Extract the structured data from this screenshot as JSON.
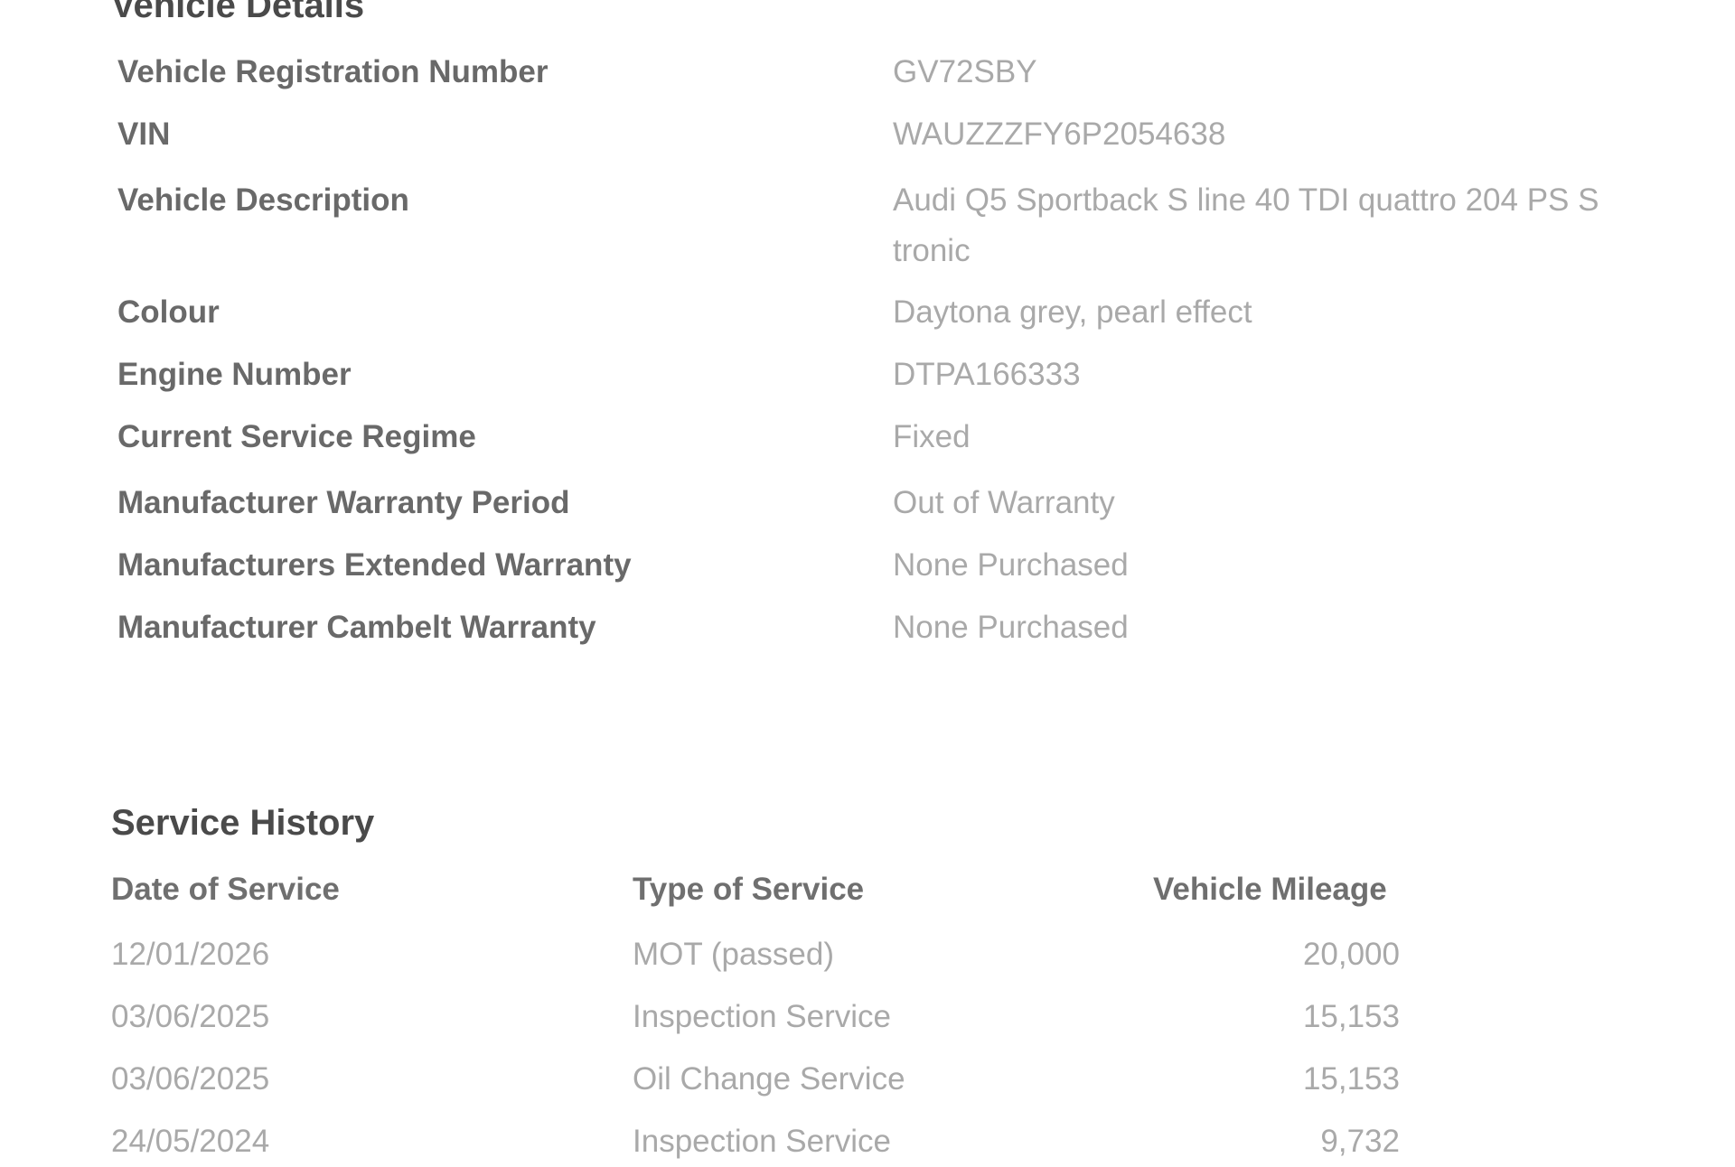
{
  "vehicle_details": {
    "title": "Vehicle Details",
    "rows": [
      {
        "label": "Vehicle Registration Number",
        "value": "GV72SBY"
      },
      {
        "label": "VIN",
        "value": "WAUZZZFY6P2054638"
      },
      {
        "label": "Vehicle Description",
        "value": "Audi Q5 Sportback S line 40 TDI quattro 204 PS S tronic"
      },
      {
        "label": "Colour",
        "value": "Daytona grey, pearl effect"
      },
      {
        "label": "Engine Number",
        "value": "DTPA166333"
      },
      {
        "label": "Current Service Regime",
        "value": "Fixed"
      },
      {
        "label": "Manufacturer Warranty Period",
        "value": "Out of Warranty"
      },
      {
        "label": "Manufacturers Extended Warranty",
        "value": "None Purchased"
      },
      {
        "label": "Manufacturer Cambelt Warranty",
        "value": "None Purchased"
      }
    ]
  },
  "service_history": {
    "title": "Service History",
    "columns": [
      "Date of Service",
      "Type of Service",
      "Vehicle Mileage"
    ],
    "rows": [
      {
        "date": "12/01/2026",
        "type": "MOT (passed)",
        "mileage": "20,000"
      },
      {
        "date": "03/06/2025",
        "type": "Inspection Service",
        "mileage": "15,153"
      },
      {
        "date": "03/06/2025",
        "type": "Oil Change Service",
        "mileage": "15,153"
      },
      {
        "date": "24/05/2024",
        "type": "Inspection Service",
        "mileage": "9,732"
      }
    ]
  }
}
